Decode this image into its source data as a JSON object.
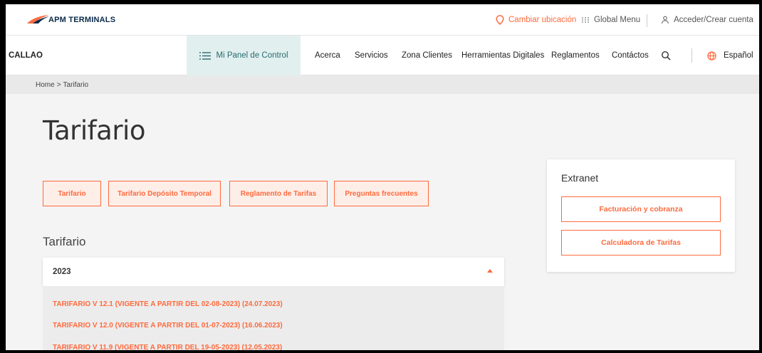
{
  "brand": {
    "logo_text": "APM TERMINALS"
  },
  "utility": {
    "location_label": "Cambiar ubicación",
    "global_menu_label": "Global Menu",
    "account_label": "Acceder/Crear cuenta"
  },
  "nav": {
    "location": "CALLAO",
    "panel_label": "Mi Panel de Control",
    "items": [
      "Acerca",
      "Servicios",
      "Zona Clientes",
      "Herramientas Digitales",
      "Reglamentos",
      "Contáctos"
    ],
    "language": "Español"
  },
  "breadcrumb": {
    "home": "Home",
    "separator": ">",
    "current": "Tarifario"
  },
  "page": {
    "title": "Tarifario",
    "tabs": [
      "Tarifario",
      "Tarifario Depósito Temporal",
      "Reglamento de Tarifas",
      "Preguntas frecuentes"
    ],
    "section_title": "Tarifario"
  },
  "accordion": {
    "year": "2023",
    "links": [
      "TARIFARIO V 12.1 (VIGENTE A PARTIR DEL 02-08-2023) (24.07.2023)",
      "TARIFARIO V 12.0 (VIGENTE A PARTIR DEL 01-07-2023) (16.06.2023)",
      "TARIFARIO V 11.9 (VIGENTE A PARTIR DEL 19-05-2023) (12.05.2023)"
    ]
  },
  "extranet": {
    "title": "Extranet",
    "buttons": [
      "Facturación y cobranza",
      "Calculadora de Tarifas"
    ]
  },
  "colors": {
    "accent": "#ff6a3d",
    "panel_bg": "#e1efef",
    "logo_navy": "#0a2a4a"
  }
}
